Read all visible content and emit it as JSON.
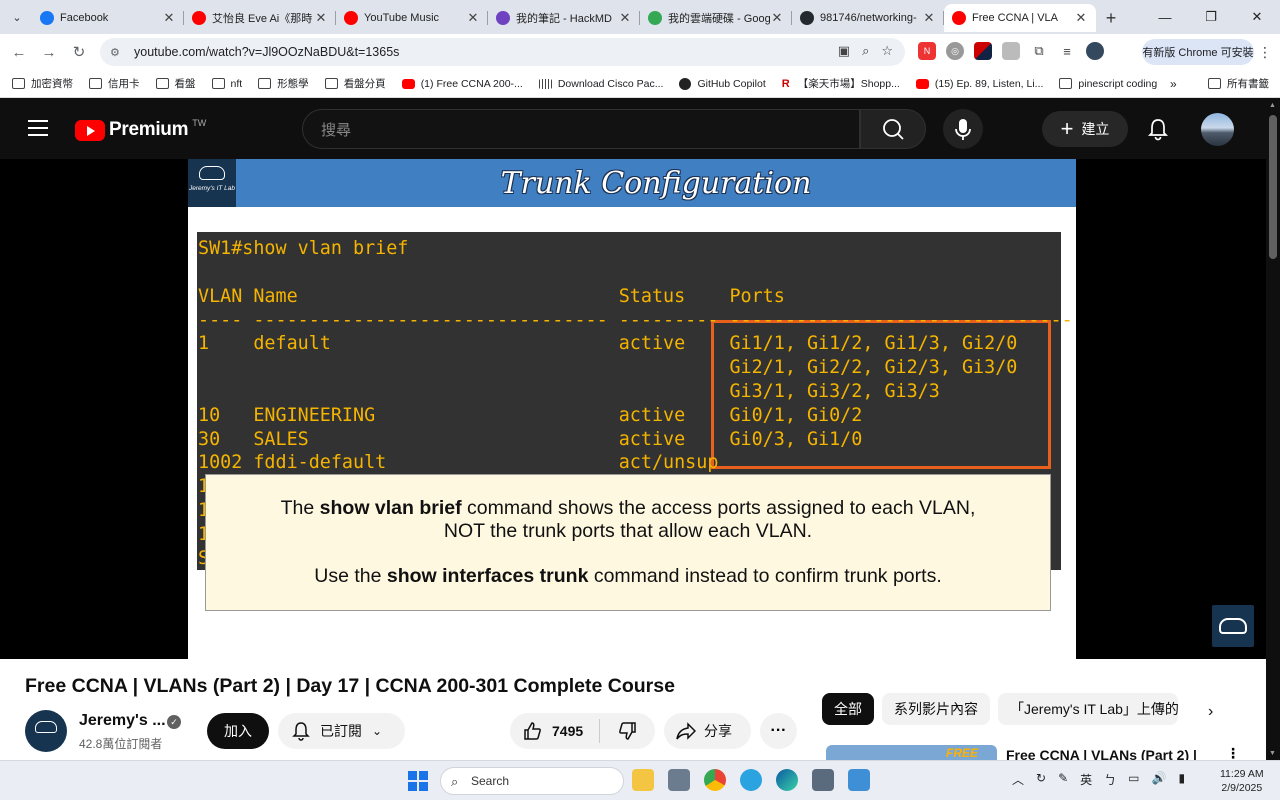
{
  "browser": {
    "tabs": [
      {
        "title": "Facebook",
        "color": "#1877f2"
      },
      {
        "title": "艾怡良 Eve Ai《那時",
        "color": "#ff0000"
      },
      {
        "title": "YouTube Music",
        "color": "#ff0000"
      },
      {
        "title": "我的筆記 - HackMD",
        "color": "#6f42c1"
      },
      {
        "title": "我的雲端硬碟 - Goog",
        "color": "#34a853"
      },
      {
        "title": "981746/networking-",
        "color": "#24292f"
      },
      {
        "title": "Free CCNA | VLA",
        "color": "#ff0000",
        "active": true
      }
    ],
    "url": "youtube.com/watch?v=Jl9OOzNaBDU&t=1365s",
    "update_button": "有新版 Chrome 可安裝",
    "bookmarks": [
      {
        "label": "加密資幣",
        "icon": "folder-icon"
      },
      {
        "label": "信用卡",
        "icon": "folder-icon"
      },
      {
        "label": "看盤",
        "icon": "folder-icon"
      },
      {
        "label": "nft",
        "icon": "folder-icon"
      },
      {
        "label": "形態學",
        "icon": "folder-icon"
      },
      {
        "label": "看盤分頁",
        "icon": "folder-icon"
      },
      {
        "label": "(1) Free CCNA 200-...",
        "icon": "youtube-icon"
      },
      {
        "label": "Download Cisco Pac...",
        "icon": "cisco-icon"
      },
      {
        "label": "GitHub Copilot",
        "icon": "github-icon"
      },
      {
        "label": "【楽天市場】Shopp...",
        "icon": "rakuten-icon"
      },
      {
        "label": "(15) Ep. 89, Listen, Li...",
        "icon": "youtube-icon"
      },
      {
        "label": "pinescript coding",
        "icon": "folder-icon"
      }
    ],
    "bookmarks_more": "»",
    "all_bookmarks": "所有書籤"
  },
  "youtube": {
    "logo_text": "Premium",
    "region": "TW",
    "search_placeholder": "搜尋",
    "create_label": "建立"
  },
  "slide": {
    "badge_text": "Jeremy's IT Lab",
    "title": "Trunk Configuration",
    "terminal_lines": [
      "SW1#show vlan brief",
      "",
      "VLAN Name                             Status    Ports",
      "---- -------------------------------- --------- -------------------------------",
      "1    default                          active    Gi1/1, Gi1/2, Gi1/3, Gi2/0",
      "                                                Gi2/1, Gi2/2, Gi2/3, Gi3/0",
      "                                                Gi3/1, Gi3/2, Gi3/3",
      "10   ENGINEERING                      active    Gi0/1, Gi0/2",
      "30   SALES                            active    Gi0/3, Gi1/0",
      "1002 fddi-default                     act/unsup"
    ],
    "note": {
      "line1_pre": "The ",
      "line1_bold": "show vlan brief",
      "line1_post": " command shows the access ports assigned to each VLAN,",
      "line2": "NOT the trunk ports that allow each VLAN.",
      "line3_pre": "Use the ",
      "line3_bold": "show interfaces trunk",
      "line3_post": " command instead to confirm trunk ports."
    },
    "highlight_color": "#e8601c",
    "terminal_text_color": "#f5b400"
  },
  "video_info": {
    "title": "Free CCNA | VLANs (Part 2) | Day 17 | CCNA 200-301 Complete Course",
    "channel_name": "Jeremy's ...",
    "subscribers": "42.8萬位訂閱者",
    "join_label": "加入",
    "subscribed_label": "已訂閱",
    "likes": "7495",
    "share_label": "分享"
  },
  "sidebar_chips": [
    "全部",
    "系列影片內容",
    "「Jeremy's IT Lab」上傳的"
  ],
  "next_video": {
    "title": "Free CCNA | VLANs (Part 2) |",
    "thumb_label": "FREE"
  },
  "taskbar": {
    "search_label": "Search",
    "ime_label": "英",
    "time": "11:29 AM",
    "date": "2/9/2025"
  }
}
